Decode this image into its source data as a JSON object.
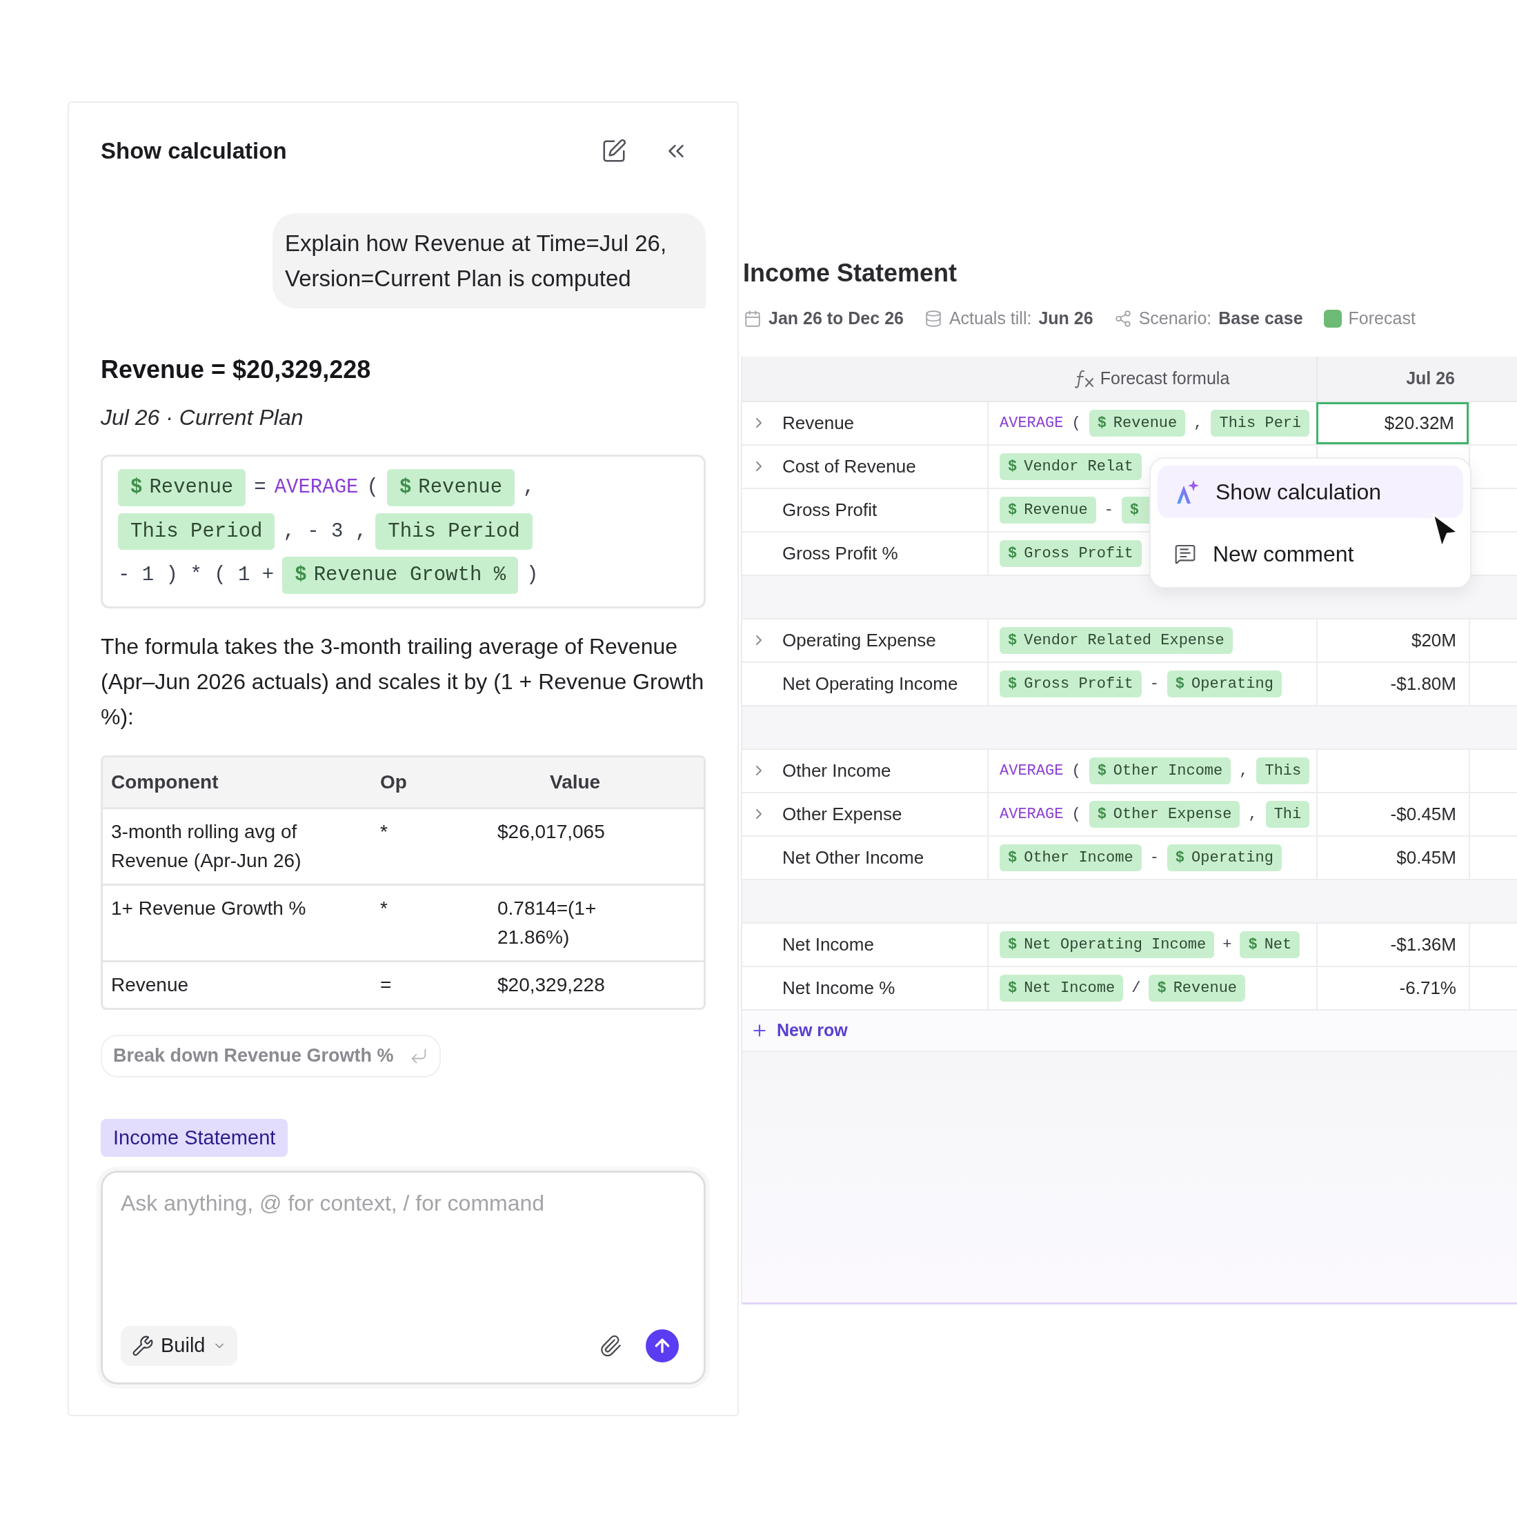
{
  "panel": {
    "title": "Show calculation",
    "message": "Explain how Revenue at Time=Jul 26, Version=Current Plan is computed",
    "result_title": "Revenue = $20,329,228",
    "result_subtitle": "Jul 26 · Current Plan",
    "formula": [
      {
        "kind": "ref",
        "sign": "$",
        "label": "Revenue"
      },
      {
        "kind": "op",
        "label": "="
      },
      {
        "kind": "fn",
        "label": "AVERAGE"
      },
      {
        "kind": "op",
        "label": "("
      },
      {
        "kind": "ref",
        "sign": "$",
        "label": "Revenue"
      },
      {
        "kind": "op",
        "label": ","
      },
      {
        "kind": "ref",
        "label": "This Period"
      },
      {
        "kind": "op",
        "label": ", - 3 ,"
      },
      {
        "kind": "ref",
        "label": "This Period"
      },
      {
        "kind": "op",
        "label": "- 1 ) * ( 1 +"
      },
      {
        "kind": "ref",
        "sign": "$",
        "label": "Revenue Growth %"
      },
      {
        "kind": "op",
        "label": ")"
      }
    ],
    "explanation": "The formula takes the 3-month trailing average of Revenue (Apr–Jun 2026 actuals) and scales it by (1 + Revenue Growth %):",
    "table": {
      "columns": [
        "Component",
        "Op",
        "Value"
      ],
      "rows": [
        {
          "component": "3-month rolling avg of Revenue (Apr-Jun 26)",
          "op": "*",
          "value": "$26,017,065"
        },
        {
          "component": "1+ Revenue Growth %",
          "op": "*",
          "value": "0.7814=(1+ 21.86%)"
        },
        {
          "component": "Revenue",
          "op": "=",
          "value": "$20,329,228"
        }
      ]
    },
    "suggestion": "Break down Revenue Growth %",
    "context_tag": "Income Statement",
    "input": {
      "placeholder": "Ask anything, @ for context, / for command"
    },
    "mode": "Build"
  },
  "sheet": {
    "title": "Income Statement",
    "meta": [
      {
        "kind": "date",
        "value": "Jan 26 to Dec 26"
      },
      {
        "kind": "actuals",
        "label": "Actuals till:",
        "value": "Jun 26"
      },
      {
        "kind": "scenario",
        "label": "Scenario:",
        "value": "Base case"
      },
      {
        "kind": "legend",
        "label": "Forecast",
        "color": "#6dbb74"
      }
    ],
    "columns": [
      "Forecast formula",
      "Jul 26"
    ],
    "groups": [
      {
        "rows": [
          {
            "name": "Revenue",
            "expandable": true,
            "selected": true,
            "value": "$20.32M",
            "formula": [
              {
                "kind": "fn",
                "label": "AVERAGE"
              },
              {
                "kind": "op",
                "label": "("
              },
              {
                "kind": "ref",
                "sign": "$",
                "label": "Revenue"
              },
              {
                "kind": "op",
                "label": ","
              },
              {
                "kind": "ref",
                "label": "This Peri"
              }
            ]
          },
          {
            "name": "Cost of Revenue",
            "expandable": true,
            "formula": [
              {
                "kind": "ref",
                "sign": "$",
                "label": "Vendor Relat"
              }
            ]
          },
          {
            "name": "Gross Profit",
            "expandable": false,
            "formula": [
              {
                "kind": "ref",
                "sign": "$",
                "label": "Revenue"
              },
              {
                "kind": "op",
                "label": "-"
              },
              {
                "kind": "ref",
                "sign": "$"
              }
            ]
          },
          {
            "name": "Gross Profit %",
            "expandable": false,
            "formula": [
              {
                "kind": "ref",
                "sign": "$",
                "label": "Gross Profit"
              }
            ]
          }
        ]
      },
      {
        "rows": [
          {
            "name": "Operating Expense",
            "expandable": true,
            "selected": false,
            "value": "$20M",
            "formula": [
              {
                "kind": "ref",
                "sign": "$",
                "label": "Vendor Related Expense"
              }
            ]
          },
          {
            "name": "Net Operating Income",
            "expandable": false,
            "selected": false,
            "value": "-$1.80M",
            "formula": [
              {
                "kind": "ref",
                "sign": "$",
                "label": "Gross Profit"
              },
              {
                "kind": "op",
                "label": "-"
              },
              {
                "kind": "ref",
                "sign": "$",
                "label": "Operating"
              }
            ]
          }
        ]
      },
      {
        "rows": [
          {
            "name": "Other Income",
            "expandable": true,
            "selected": false,
            "formula": [
              {
                "kind": "fn",
                "label": "AVERAGE"
              },
              {
                "kind": "op",
                "label": "("
              },
              {
                "kind": "ref",
                "sign": "$",
                "label": "Other Income"
              },
              {
                "kind": "op",
                "label": ","
              },
              {
                "kind": "ref",
                "label": "This"
              }
            ]
          },
          {
            "name": "Other Expense",
            "expandable": true,
            "selected": false,
            "value": "-$0.45M",
            "formula": [
              {
                "kind": "fn",
                "label": "AVERAGE"
              },
              {
                "kind": "op",
                "label": "("
              },
              {
                "kind": "ref",
                "sign": "$",
                "label": "Other Expense"
              },
              {
                "kind": "op",
                "label": ","
              },
              {
                "kind": "ref",
                "label": "Thi"
              }
            ]
          },
          {
            "name": "Net Other Income",
            "expandable": false,
            "selected": false,
            "value": "$0.45M",
            "formula": [
              {
                "kind": "ref",
                "sign": "$",
                "label": "Other Income"
              },
              {
                "kind": "op",
                "label": "-"
              },
              {
                "kind": "ref",
                "sign": "$",
                "label": "Operating"
              }
            ]
          }
        ]
      },
      {
        "rows": [
          {
            "name": "Net Income",
            "expandable": false,
            "selected": false,
            "value": "-$1.36M",
            "formula": [
              {
                "kind": "ref",
                "sign": "$",
                "label": "Net Operating Income"
              },
              {
                "kind": "op",
                "label": "+"
              },
              {
                "kind": "ref",
                "sign": "$",
                "label": "Net"
              }
            ]
          },
          {
            "name": "Net Income %",
            "expandable": false,
            "selected": false,
            "value": "-6.71%",
            "formula": [
              {
                "kind": "ref",
                "sign": "$",
                "label": "Net Income"
              },
              {
                "kind": "op",
                "label": "/"
              },
              {
                "kind": "ref",
                "sign": "$",
                "label": "Revenue"
              }
            ]
          }
        ]
      }
    ],
    "new_row": "New row",
    "menu": [
      {
        "kind": "ai",
        "label": "Show calculation",
        "selected": true
      },
      {
        "kind": "comment",
        "label": "New comment",
        "selected": false
      }
    ]
  }
}
